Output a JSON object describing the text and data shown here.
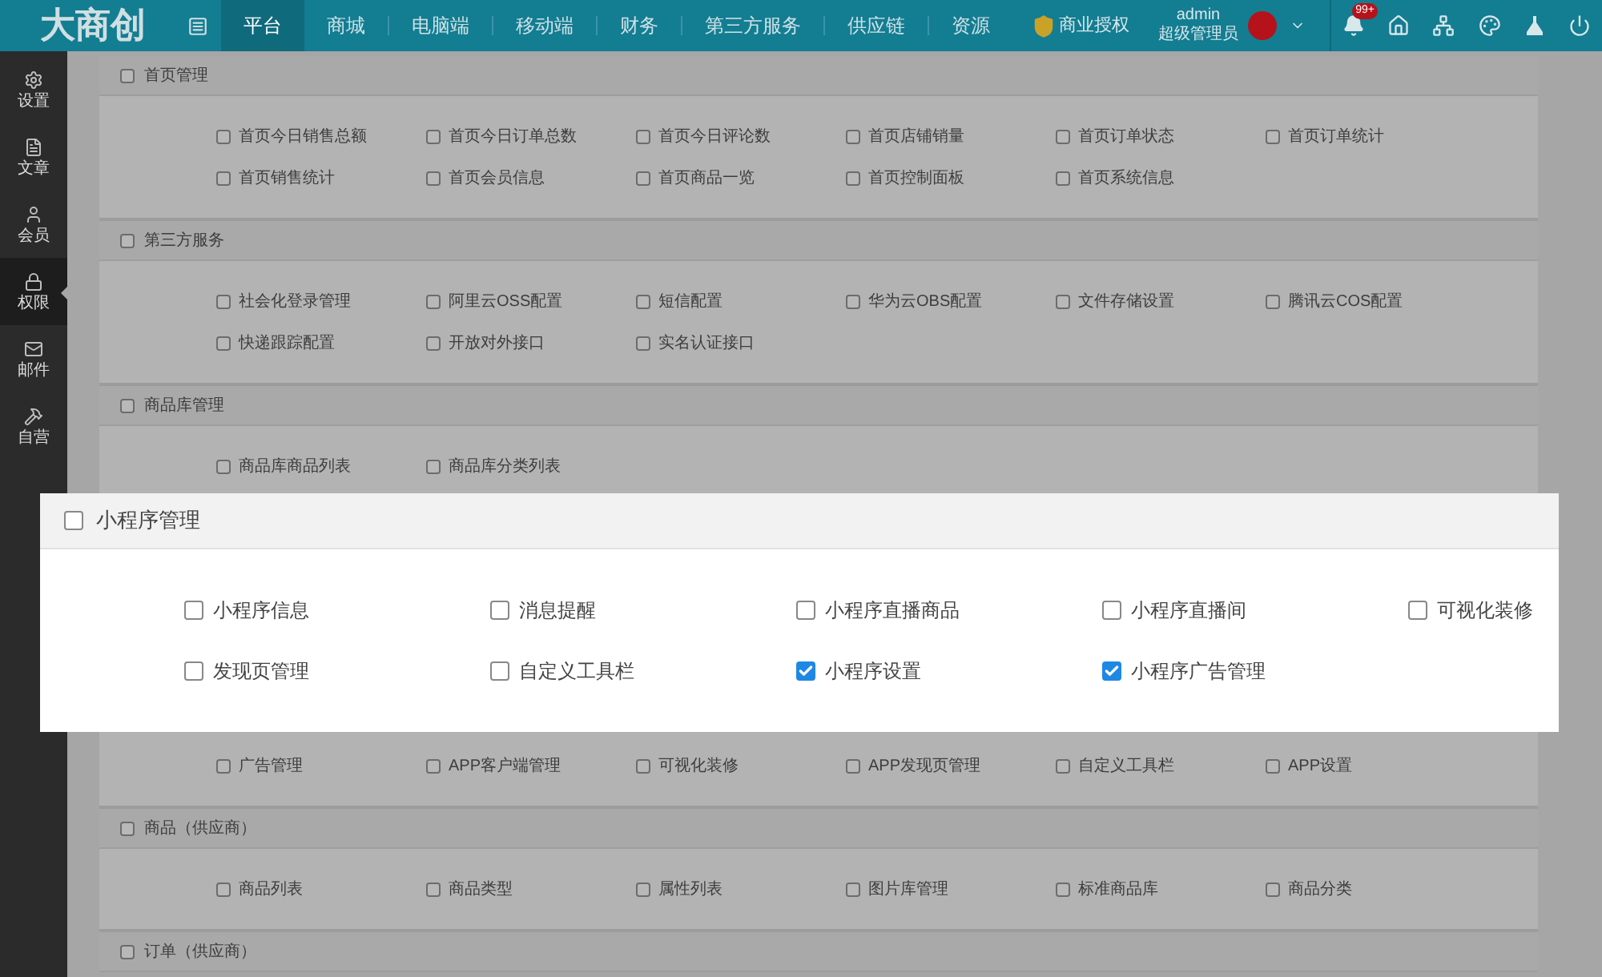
{
  "header": {
    "logo": "大商创",
    "nav": [
      {
        "label": "平台",
        "selected": true
      },
      {
        "label": "商城",
        "selected": false
      },
      {
        "label": "电脑端",
        "selected": false
      },
      {
        "label": "移动端",
        "selected": false
      },
      {
        "label": "财务",
        "selected": false
      },
      {
        "label": "第三方服务",
        "selected": false
      },
      {
        "label": "供应链",
        "selected": false
      },
      {
        "label": "资源",
        "selected": false
      }
    ],
    "license": "商业授权",
    "user": {
      "name": "admin",
      "role": "超级管理员"
    },
    "notification_badge": "99+"
  },
  "sidebar": {
    "items": [
      {
        "kind": "settings",
        "label": "设置",
        "selected": false
      },
      {
        "kind": "article",
        "label": "文章",
        "selected": false
      },
      {
        "kind": "member",
        "label": "会员",
        "selected": false
      },
      {
        "kind": "permission",
        "label": "权限",
        "selected": true
      },
      {
        "kind": "mail",
        "label": "邮件",
        "selected": false
      },
      {
        "kind": "self",
        "label": "自营",
        "selected": false
      }
    ]
  },
  "sections": [
    {
      "title": "首页管理",
      "checked": false,
      "items": [
        {
          "label": "首页今日销售总额",
          "checked": false
        },
        {
          "label": "首页今日订单总数",
          "checked": false
        },
        {
          "label": "首页今日评论数",
          "checked": false
        },
        {
          "label": "首页店铺销量",
          "checked": false
        },
        {
          "label": "首页订单状态",
          "checked": false
        },
        {
          "label": "首页订单统计",
          "checked": false
        },
        {
          "label": "首页销售统计",
          "checked": false
        },
        {
          "label": "首页会员信息",
          "checked": false
        },
        {
          "label": "首页商品一览",
          "checked": false
        },
        {
          "label": "首页控制面板",
          "checked": false
        },
        {
          "label": "首页系统信息",
          "checked": false
        }
      ]
    },
    {
      "title": "第三方服务",
      "checked": false,
      "items": [
        {
          "label": "社会化登录管理",
          "checked": false
        },
        {
          "label": "阿里云OSS配置",
          "checked": false
        },
        {
          "label": "短信配置",
          "checked": false
        },
        {
          "label": "华为云OBS配置",
          "checked": false
        },
        {
          "label": "文件存储设置",
          "checked": false
        },
        {
          "label": "腾讯云COS配置",
          "checked": false
        },
        {
          "label": "快递跟踪配置",
          "checked": false
        },
        {
          "label": "开放对外接口",
          "checked": false
        },
        {
          "label": "实名认证接口",
          "checked": false
        }
      ]
    },
    {
      "title": "商品库管理",
      "checked": false,
      "items": [
        {
          "label": "商品库商品列表",
          "checked": false
        },
        {
          "label": "商品库分类列表",
          "checked": false
        }
      ]
    },
    {
      "items": [
        {
          "label": "广告管理",
          "checked": false
        },
        {
          "label": "APP客户端管理",
          "checked": false
        },
        {
          "label": "可视化装修",
          "checked": false
        },
        {
          "label": "APP发现页管理",
          "checked": false
        },
        {
          "label": "自定义工具栏",
          "checked": false
        },
        {
          "label": "APP设置",
          "checked": false
        }
      ]
    },
    {
      "title": "商品（供应商）",
      "checked": false,
      "items": [
        {
          "label": "商品列表",
          "checked": false
        },
        {
          "label": "商品类型",
          "checked": false
        },
        {
          "label": "属性列表",
          "checked": false
        },
        {
          "label": "图片库管理",
          "checked": false
        },
        {
          "label": "标准商品库",
          "checked": false
        },
        {
          "label": "商品分类",
          "checked": false
        }
      ]
    },
    {
      "title": "订单（供应商）",
      "checked": false
    }
  ],
  "highlight_card": {
    "title": "小程序管理",
    "checked": false,
    "items": [
      {
        "label": "小程序信息",
        "checked": false
      },
      {
        "label": "消息提醒",
        "checked": false
      },
      {
        "label": "小程序直播商品",
        "checked": false
      },
      {
        "label": "小程序直播间",
        "checked": false
      },
      {
        "label": "可视化装修",
        "checked": false
      },
      {
        "label": "发现页管理",
        "checked": false
      },
      {
        "label": "自定义工具栏",
        "checked": false
      },
      {
        "label": "小程序设置",
        "checked": true
      },
      {
        "label": "小程序广告管理",
        "checked": true
      }
    ]
  }
}
